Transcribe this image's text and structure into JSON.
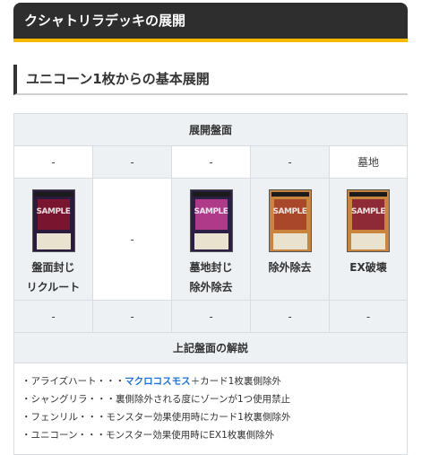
{
  "section_title": "クシャトリラデッキの展開",
  "sub_title": "ユニコーン1枚からの基本展開",
  "board": {
    "title": "展開盤面",
    "top_row": [
      "-",
      "-",
      "-",
      "-",
      "墓地"
    ],
    "cards": [
      {
        "label_line1": "盤面封じ",
        "label_line2": "リクルート",
        "color": "#2a1a3e",
        "art": "#7a1530"
      },
      {
        "label_line1": "-",
        "label_line2": "",
        "color": "",
        "art": ""
      },
      {
        "label_line1": "墓地封じ",
        "label_line2": "除外除去",
        "color": "#2b1f45",
        "art": "#b03a8a"
      },
      {
        "label_line1": "除外除去",
        "label_line2": "",
        "color": "#c9853e",
        "art": "#a9472a"
      },
      {
        "label_line1": "EX破壊",
        "label_line2": "",
        "color": "#c9853e",
        "art": "#8e2a36"
      }
    ],
    "bottom_row": [
      "-",
      "-",
      "-",
      "-",
      "-"
    ],
    "card_watermark": "SAMPLE"
  },
  "explanation": {
    "title": "上記盤面の解説",
    "lines": [
      {
        "prefix": "・アライズハート・・・",
        "highlight": "マクロコスモス",
        "suffix": "＋カード1枚裏側除外"
      },
      {
        "prefix": "・シャングリラ・・・裏側除外される度にゾーンが1つ使用禁止",
        "highlight": "",
        "suffix": ""
      },
      {
        "prefix": "・フェンリル・・・モンスター効果使用時にカード1枚裏側除外",
        "highlight": "",
        "suffix": ""
      },
      {
        "prefix": "・ユニコーン・・・モンスター効果使用時にEX1枚裏側除外",
        "highlight": "",
        "suffix": ""
      }
    ]
  },
  "colors": {
    "header_bg": "#2e2e2e",
    "accent": "#f5b700",
    "highlight": "#1e73d8"
  }
}
